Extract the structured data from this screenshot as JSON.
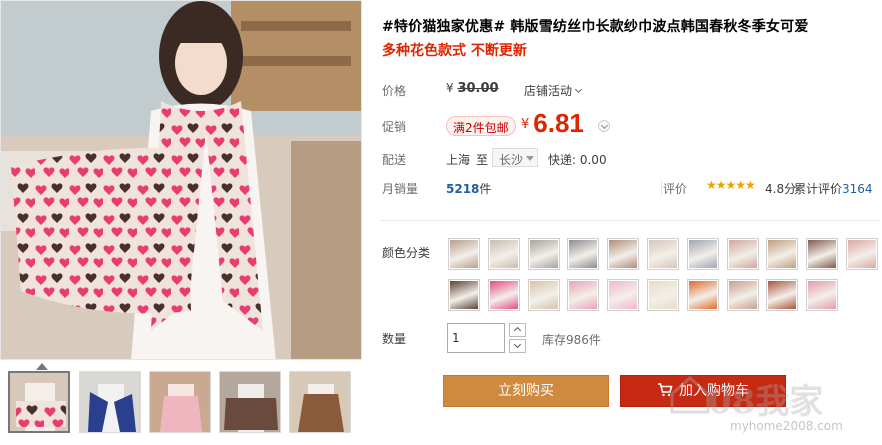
{
  "product": {
    "title": "#特价猫独家优惠# 韩版雪纺丝巾长款纱巾波点韩国春秋冬季女可爱",
    "subtitle": "多种花色款式 不断更新"
  },
  "price": {
    "label": "价格",
    "currency_symbol": "¥",
    "original": "30.00",
    "activity_select": "店铺活动"
  },
  "promo": {
    "label": "促销",
    "tag": "满2件包邮",
    "currency_symbol": "¥",
    "price": "6.81"
  },
  "shipping": {
    "label": "配送",
    "from": "上海",
    "to_word": "至",
    "destination": "长沙",
    "fee": "快递: 0.00"
  },
  "sales": {
    "label": "月销量",
    "count": "5218",
    "unit": "件"
  },
  "rating": {
    "label": "评价",
    "stars": "★★★★★",
    "score": "4.8分",
    "review_prefix": "累计评价",
    "review_count": "3164"
  },
  "colors": {
    "label": "颜色分类",
    "swatches": [
      {
        "color": "#b7a08a"
      },
      {
        "color": "#c9bdb0"
      },
      {
        "color": "#a8a49c"
      },
      {
        "color": "#8c8d90"
      },
      {
        "color": "#b08c78"
      },
      {
        "color": "#d6c6bb"
      },
      {
        "color": "#9ea4b5"
      },
      {
        "color": "#cfa69c"
      },
      {
        "color": "#c29d7e"
      },
      {
        "color": "#7f5a4d"
      },
      {
        "color": "#d9a9a1"
      },
      {
        "color": "#5c4135"
      },
      {
        "color": "#e14b86"
      },
      {
        "color": "#d8c4a7"
      },
      {
        "color": "#e8a3b9"
      },
      {
        "color": "#f1b8cd"
      },
      {
        "color": "#e8dcc4"
      },
      {
        "color": "#e06a2c"
      },
      {
        "color": "#c6a08a"
      },
      {
        "color": "#a8553e"
      },
      {
        "color": "#e59ab0"
      }
    ]
  },
  "quantity": {
    "label": "数量",
    "value": "1",
    "stock": "库存986件"
  },
  "actions": {
    "buy_now": "立刻购买",
    "add_to_cart": "加入购物车"
  },
  "watermark": {
    "text": "08我家",
    "url": "myhome2008.com"
  }
}
